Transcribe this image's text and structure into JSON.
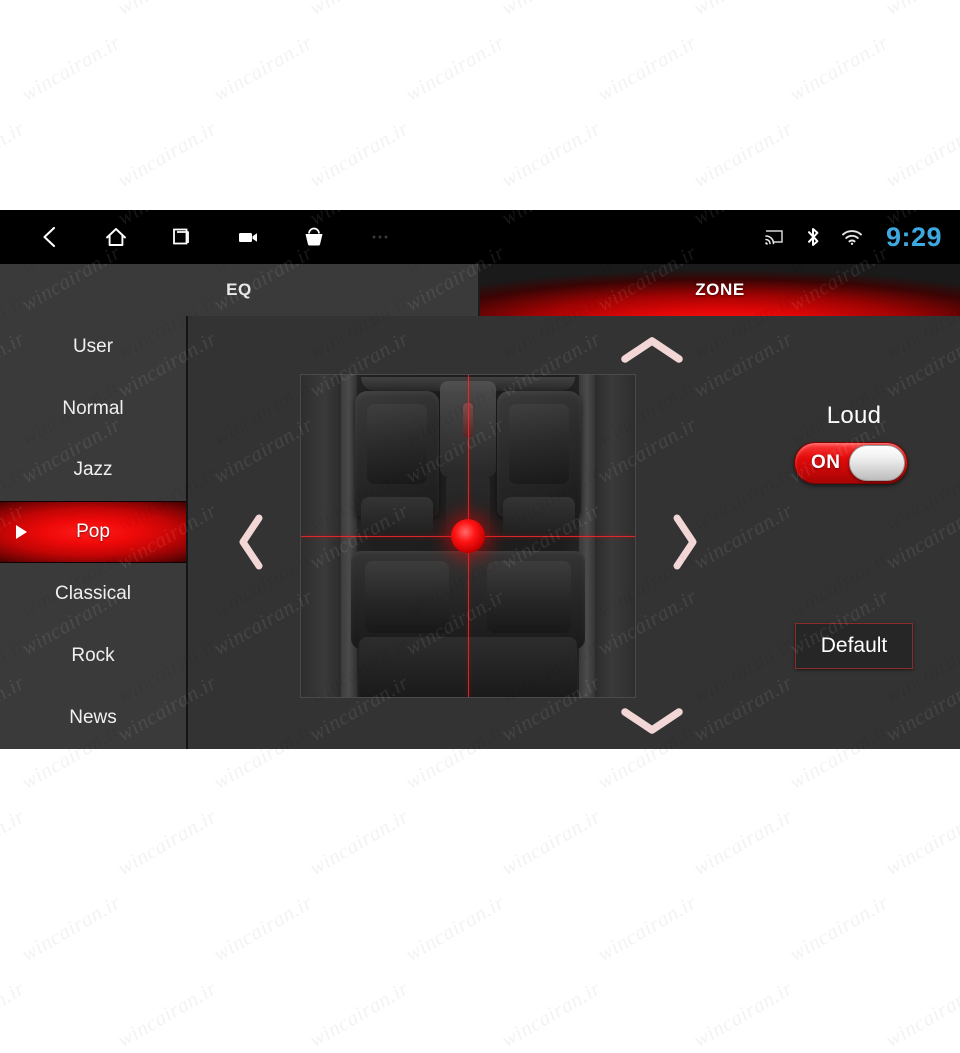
{
  "statusbar": {
    "nav_icons": [
      {
        "name": "back-icon",
        "glyph": "chevron-left"
      },
      {
        "name": "home-icon",
        "glyph": "house"
      },
      {
        "name": "recents-icon",
        "glyph": "square-stack"
      },
      {
        "name": "video-recorder-icon",
        "glyph": "camcorder"
      },
      {
        "name": "apps-basket-icon",
        "glyph": "basket"
      },
      {
        "name": "more-dots-icon",
        "glyph": "ellipsis"
      }
    ],
    "system_icons": [
      {
        "name": "cast-icon",
        "glyph": "cast"
      },
      {
        "name": "bluetooth-icon",
        "glyph": "bluetooth"
      },
      {
        "name": "wifi-icon",
        "glyph": "wifi"
      }
    ],
    "clock": "9:29",
    "clock_color": "#3da9e0"
  },
  "tabs": [
    {
      "id": "eq",
      "label": "EQ",
      "active": false
    },
    {
      "id": "zone",
      "label": "ZONE",
      "active": true
    }
  ],
  "presets": [
    {
      "label": "User",
      "active": false
    },
    {
      "label": "Normal",
      "active": false
    },
    {
      "label": "Jazz",
      "active": false
    },
    {
      "label": "Pop",
      "active": true
    },
    {
      "label": "Classical",
      "active": false
    },
    {
      "label": "Rock",
      "active": false
    },
    {
      "label": "News",
      "active": false
    }
  ],
  "fader": {
    "up_icon": "chevron-up-icon",
    "down_icon": "chevron-down-icon",
    "left_icon": "chevron-left-icon",
    "right_icon": "chevron-right-icon",
    "balance_position": "center",
    "fader_position": "center",
    "marker_color": "#ff1414",
    "crosshair_color": "#ff2a2a"
  },
  "controls": {
    "loud_label": "Loud",
    "loud_state": "ON",
    "loud_on_color": "#e20b0b",
    "default_label": "Default"
  },
  "watermark": {
    "text": "wincairan.ir"
  },
  "theme": {
    "panel_bg": "#333333",
    "sidebar_bg": "#3a3a3a",
    "statusbar_bg": "#000000",
    "accent_red": "#e20b0b",
    "text_color": "#f0f0f0"
  }
}
